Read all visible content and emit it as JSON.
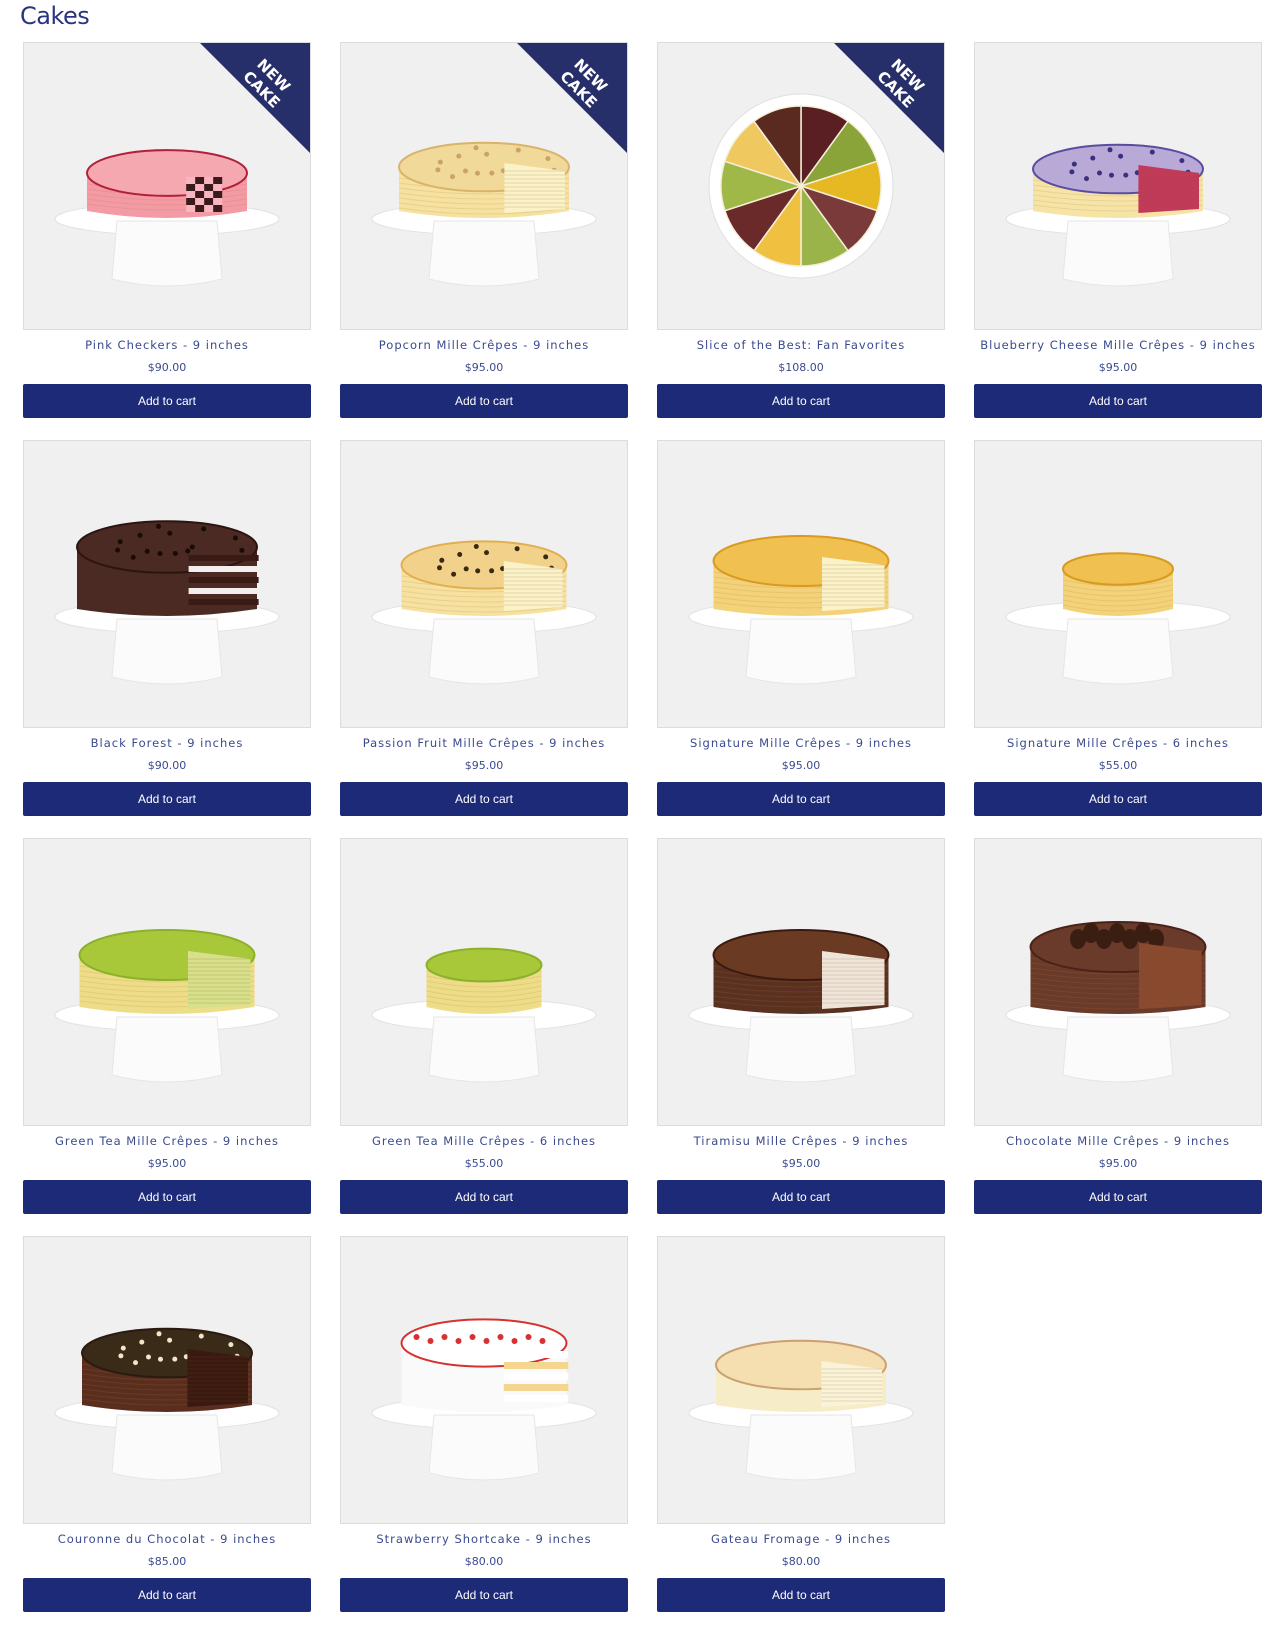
{
  "page": {
    "title": "Cakes"
  },
  "accent_color": "#1c2a78",
  "products": [
    {
      "name": "Pink Checkers - 9 inches",
      "price": "$90.00",
      "button": "Add to cart",
      "badge": "NEW CAKE",
      "image": "pink-checkers"
    },
    {
      "name": "Popcorn Mille Crêpes - 9 inches",
      "price": "$95.00",
      "button": "Add to cart",
      "badge": "NEW CAKE",
      "image": "popcorn"
    },
    {
      "name": "Slice of the Best: Fan Favorites",
      "price": "$108.00",
      "button": "Add to cart",
      "badge": "NEW CAKE",
      "image": "slices-top"
    },
    {
      "name": "Blueberry Cheese Mille Crêpes - 9 inches",
      "price": "$95.00",
      "button": "Add to cart",
      "badge": "",
      "image": "blueberry"
    },
    {
      "name": "Black Forest - 9 inches",
      "price": "$90.00",
      "button": "Add to cart",
      "badge": "",
      "image": "black-forest"
    },
    {
      "name": "Passion Fruit Mille Crêpes - 9 inches",
      "price": "$95.00",
      "button": "Add to cart",
      "badge": "",
      "image": "passion"
    },
    {
      "name": "Signature Mille Crêpes - 9 inches",
      "price": "$95.00",
      "button": "Add to cart",
      "badge": "",
      "image": "signature9"
    },
    {
      "name": "Signature Mille Crêpes - 6 inches",
      "price": "$55.00",
      "button": "Add to cart",
      "badge": "",
      "image": "signature6"
    },
    {
      "name": "Green Tea Mille Crêpes - 9 inches",
      "price": "$95.00",
      "button": "Add to cart",
      "badge": "",
      "image": "greentea9"
    },
    {
      "name": "Green Tea Mille Crêpes - 6 inches",
      "price": "$55.00",
      "button": "Add to cart",
      "badge": "",
      "image": "greentea6"
    },
    {
      "name": "Tiramisu Mille Crêpes - 9 inches",
      "price": "$95.00",
      "button": "Add to cart",
      "badge": "",
      "image": "tiramisu"
    },
    {
      "name": "Chocolate Mille Crêpes - 9 inches",
      "price": "$95.00",
      "button": "Add to cart",
      "badge": "",
      "image": "chocolate"
    },
    {
      "name": "Couronne du Chocolat - 9 inches",
      "price": "$85.00",
      "button": "Add to cart",
      "badge": "",
      "image": "couronne"
    },
    {
      "name": "Strawberry Shortcake - 9 inches",
      "price": "$80.00",
      "button": "Add to cart",
      "badge": "",
      "image": "strawberry"
    },
    {
      "name": "Gateau Fromage - 9 inches",
      "price": "$80.00",
      "button": "Add to cart",
      "badge": "",
      "image": "fromage"
    }
  ]
}
